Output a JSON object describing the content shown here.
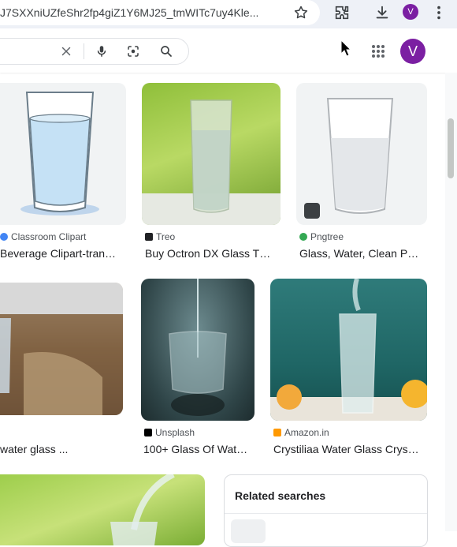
{
  "browser": {
    "url": "J7SXXniUZfeShr2fp4giZ1Y6MJ25_tmWITc7uy4Kle...",
    "profile_initial": "V"
  },
  "header": {
    "avatar_initial": "V"
  },
  "results": [
    {
      "source": "Classroom Clipart",
      "title": "Beverage Clipart-tran…",
      "favicon_color": "#4285f4"
    },
    {
      "source": "Treo",
      "title": "Buy Octron DX Glass T…",
      "favicon_color": "#202124"
    },
    {
      "source": "Pngtree",
      "title": "Glass, Water, Clean P…",
      "favicon_color": "#34a853"
    },
    {
      "source": "",
      "title": "water glass ...",
      "favicon_color": ""
    },
    {
      "source": "Unsplash",
      "title": "100+ Glass Of Wat…",
      "favicon_color": "#000000"
    },
    {
      "source": "Amazon.in",
      "title": "Crystiliaa Water Glass Crys…",
      "favicon_color": "#ff9900"
    }
  ],
  "related": {
    "title": "Related searches"
  }
}
